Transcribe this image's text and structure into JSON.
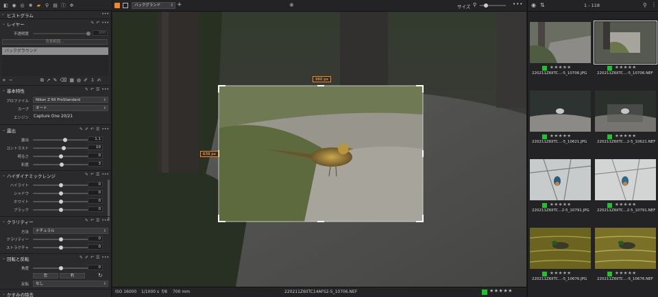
{
  "left_panel": {
    "sections": {
      "histogram": "ヒストグラム",
      "layers": "レイヤー",
      "opacity_label": "不透明度",
      "opacity_value": "100",
      "layer_button": "背景範囲...",
      "layer_item": "バックグラウンド",
      "base": "基本特性",
      "profile_label": "プロファイル",
      "profile_value": "Nikon Z 6II ProStandard",
      "curve_label": "カーブ",
      "curve_value": "オート",
      "engine_label": "エンジン",
      "engine_value": "Capture One 20/21",
      "exposure": "露出",
      "exposure_label": "露出",
      "exposure_value": "1.1",
      "contrast_label": "コントラスト",
      "contrast_value": "10",
      "brightness_label": "明るさ",
      "brightness_value": "0",
      "saturation_label": "彩度",
      "saturation_value": "3",
      "hdr": "ハイダイナミックレンジ",
      "highlight_label": "ハイライト",
      "highlight_value": "0",
      "shadow_label": "シャドウ",
      "shadow_value": "0",
      "white_label": "ホワイト",
      "white_value": "0",
      "black_label": "ブラック",
      "black_value": "0",
      "clarity": "クラリティー",
      "method_label": "方法",
      "method_value": "ナチュラル",
      "clarity_label": "クラリティー",
      "clarity_value": "0",
      "structure_label": "ストラクチャ",
      "structure_value": "0",
      "rotate": "回転と反転",
      "angle_label": "角度",
      "angle_value": "0",
      "left_btn": "左",
      "right_btn": "右",
      "flip_label": "反転",
      "flip_value": "なし",
      "moire": "かすみの除去"
    }
  },
  "center": {
    "layer_select": "バックグランド",
    "size_label": "サイズ",
    "crop_width": "960 px",
    "crop_height": "639 px",
    "iso": "ISO 16000",
    "shutter": "1/1000 s",
    "aperture": "f/8",
    "focal": "700 mm",
    "filename": "220211Z6IITC14AFS2-5_10706.NEF",
    "stars": "★★★★★",
    "rating_color": "#1fc42d"
  },
  "right_panel": {
    "count": "1 - 118",
    "thumbs": [
      {
        "name": "220211Z6IITC...-5_10706.JPG",
        "stars": "★★★★★"
      },
      {
        "name": "220211Z6IITC...-5_10706.NEF",
        "stars": "★★★★★"
      },
      {
        "name": "220211Z6IITC...-5_10621.JPG",
        "stars": "★★★★★"
      },
      {
        "name": "220211Z6IITC...2-5_10621.NEF",
        "stars": "★★★★★"
      },
      {
        "name": "220211Z6IITC...2-5_10791.JPG",
        "stars": "★★★★★"
      },
      {
        "name": "220211Z6IITC...2-5_10791.NEF",
        "stars": "★★★★★"
      },
      {
        "name": "220211Z6IITC...-5_10676.JPG",
        "stars": "★★★★★"
      },
      {
        "name": "220211Z6IITC...-5_10676.NEF",
        "stars": "★★★★★"
      }
    ]
  },
  "colors": {
    "accent": "#f08a24",
    "green_tag": "#1fc42d"
  }
}
